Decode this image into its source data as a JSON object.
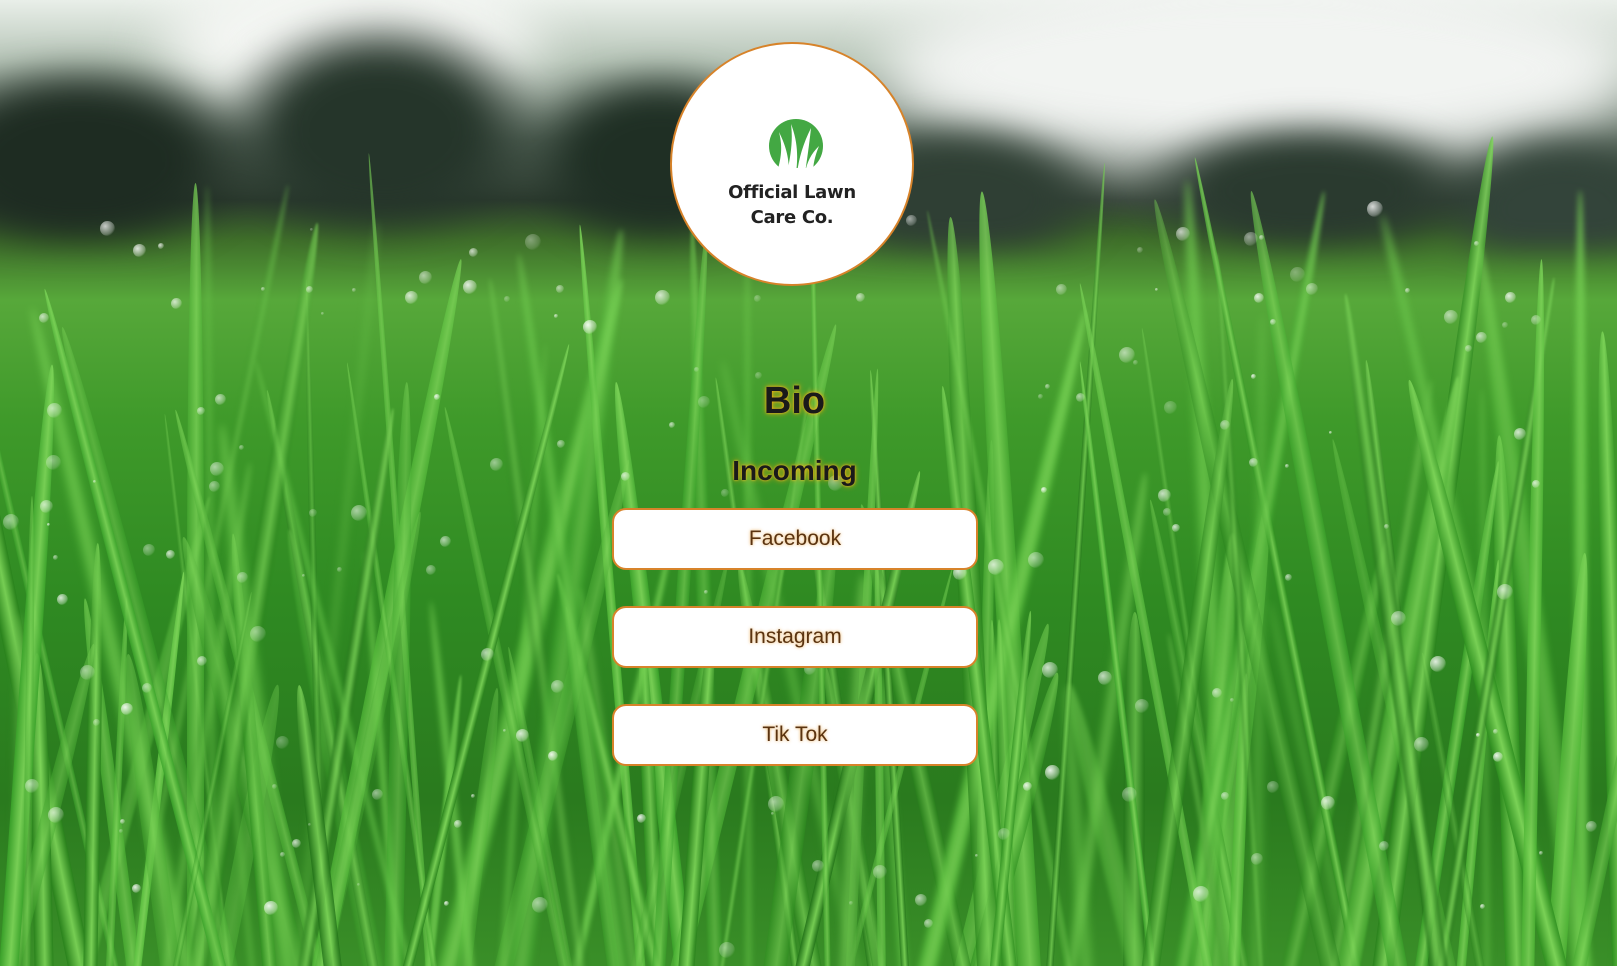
{
  "logo": {
    "line1": "Official Lawn",
    "line2": "Care Co.",
    "icon": "grass-logo-icon",
    "brand_green": "#43a843"
  },
  "bio": {
    "title": "Bio",
    "text": "Incoming"
  },
  "links": [
    {
      "label": "Facebook"
    },
    {
      "label": "Instagram"
    },
    {
      "label": "Tik Tok"
    }
  ],
  "colors": {
    "accent_border": "#d7832a",
    "button_bg": "#ffffff",
    "button_text": "#5a3310",
    "title_glow": "#ffaa00"
  }
}
